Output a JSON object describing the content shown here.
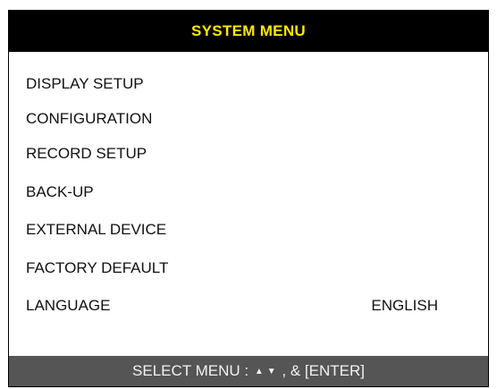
{
  "header": {
    "title": "SYSTEM MENU"
  },
  "menu": {
    "items": [
      {
        "label": "DISPLAY SETUP"
      },
      {
        "label": "CONFIGURATION"
      },
      {
        "label": "RECORD SETUP"
      },
      {
        "label": "BACK-UP"
      },
      {
        "label": "EXTERNAL DEVICE"
      },
      {
        "label": "FACTORY DEFAULT"
      },
      {
        "label": "LANGUAGE",
        "value": "ENGLISH"
      }
    ]
  },
  "footer": {
    "prefix": "SELECT MENU :",
    "up_symbol": "▲",
    "down_symbol": "▼",
    "suffix": ", & [ENTER]"
  }
}
